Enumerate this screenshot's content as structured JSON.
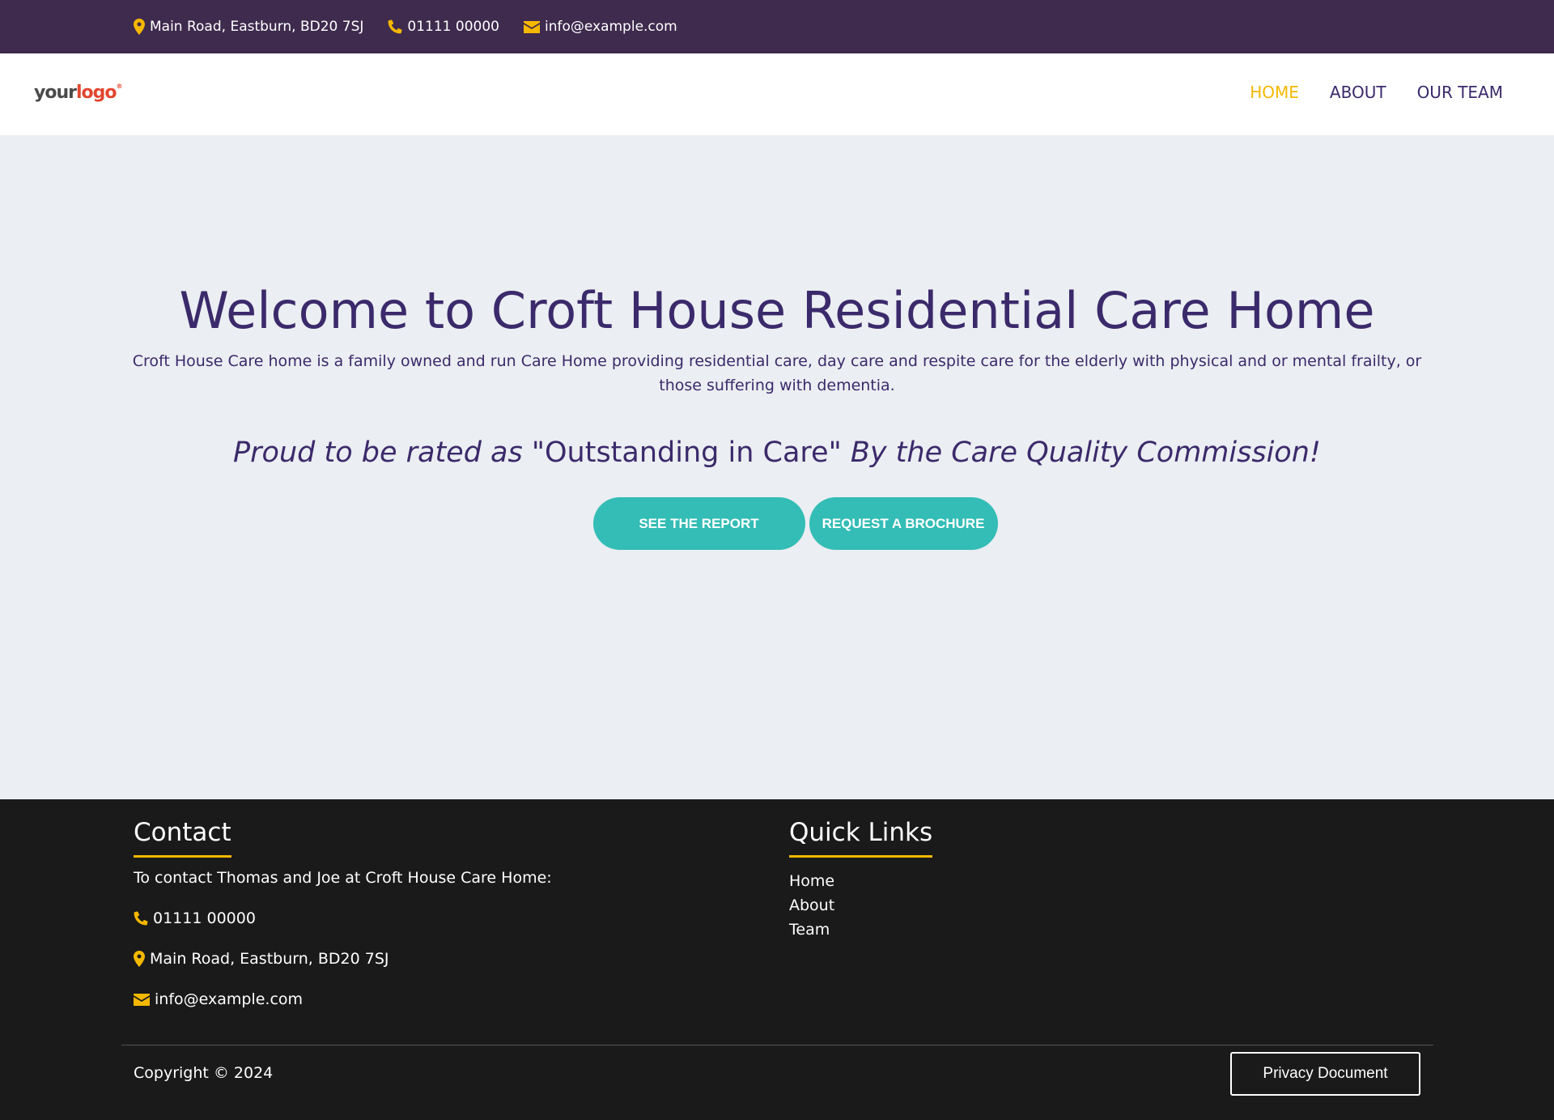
{
  "colors": {
    "topbar_bg": "#3f2b4e",
    "accent_yellow": "#f5b800",
    "primary_purple": "#3b2a6b",
    "button_teal": "#33bdb6",
    "footer_bg": "#1a1a1a",
    "logo_red": "#e2462f"
  },
  "topbar": {
    "address": "Main Road, Eastburn, BD20 7SJ",
    "address_icon": "map-marker-icon",
    "phone": "01111 00000",
    "phone_icon": "phone-icon",
    "email": "info@example.com",
    "email_icon": "envelope-icon"
  },
  "header": {
    "logo_part1": "your",
    "logo_part2": "logo",
    "logo_reg": "®",
    "nav": [
      {
        "label": "HOME",
        "active": true
      },
      {
        "label": "ABOUT",
        "active": false
      },
      {
        "label": "OUR TEAM",
        "active": false
      }
    ]
  },
  "hero": {
    "title": "Welcome to Croft House Residential Care Home",
    "description": "Croft House Care home is a family owned and run Care Home providing residential care, day care and respite care for the elderly with physical and or mental frailty, or those suffering with dementia.",
    "rating_prefix": "Proud to be rated as",
    "rating_quote": "\"Outstanding in Care\"",
    "rating_suffix": "By the Care Quality Commission!",
    "button_report": "SEE THE REPORT",
    "button_brochure": "REQUEST A BROCHURE"
  },
  "footer": {
    "contact_heading": "Contact",
    "contact_intro": "To contact Thomas and Joe at Croft House Care Home:",
    "phone": "01111 00000",
    "address": "Main Road, Eastburn, BD20 7SJ",
    "email": "info@example.com",
    "links_heading": "Quick Links",
    "links": [
      "Home",
      "About",
      "Team"
    ],
    "copyright": "Copyright © 2024",
    "privacy_button": "Privacy Document"
  }
}
